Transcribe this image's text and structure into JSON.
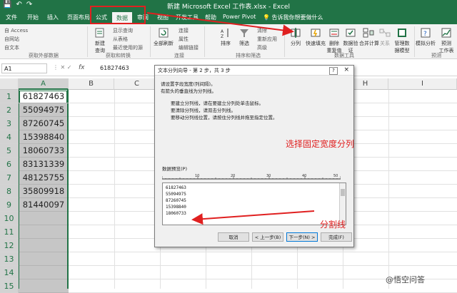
{
  "window": {
    "title": "新建 Microsoft Excel 工作表.xlsx  -  Excel"
  },
  "tabs": [
    "文件",
    "开始",
    "插入",
    "页面布局",
    "公式",
    "数据",
    "审阅",
    "视图",
    "开发工具",
    "帮助",
    "Power Pivot"
  ],
  "tell_me": "告诉我你想要做什么",
  "ribbon": {
    "external": {
      "items": [
        "自 Access",
        "自网站",
        "自文本"
      ],
      "group": "获取外部数据"
    },
    "get_transform": {
      "new_query": "新建\n查询",
      "items": [
        "显示查询",
        "从表格",
        "最近使用的源"
      ],
      "group": "获取和转换"
    },
    "connections": {
      "refresh_all": "全部刷新",
      "items": [
        "连接",
        "属性",
        "编辑链接"
      ],
      "group": "连接"
    },
    "sort_filter": {
      "sort": "排序",
      "filter": "筛选",
      "items": [
        "清除",
        "重新应用",
        "高级"
      ],
      "group": "排序和筛选"
    },
    "data_tools": {
      "items": [
        "分列",
        "快速填充",
        "删除\n重复值",
        "数据验\n证",
        "合并计算",
        "关系",
        "管理数\n据模型"
      ],
      "group": "数据工具"
    },
    "forecast": {
      "items": [
        "模拟分析",
        "预测\n工作表"
      ],
      "group": "预测"
    }
  },
  "formula_bar": {
    "name_box": "A1",
    "fx": "fx",
    "value": "61827463"
  },
  "columns": [
    "A",
    "B",
    "C",
    "D",
    "E",
    "F",
    "G",
    "H",
    "I"
  ],
  "rows": [
    "1",
    "2",
    "3",
    "4",
    "5",
    "6",
    "7",
    "8",
    "9",
    "10",
    "11",
    "12",
    "13",
    "14",
    "15"
  ],
  "cells_A": [
    "61827463",
    "55094975",
    "87260745",
    "15398840",
    "18060733",
    "83131339",
    "48125755",
    "35809918",
    "81440097"
  ],
  "dialog": {
    "title": "文本分列向导 - 第 2 步，共 3 步",
    "help": "?",
    "close": "×",
    "intro": [
      "请设置字段宽度(列间隔)。",
      "有箭头的垂直线为分列线。"
    ],
    "instructions": [
      "要建立分列线，请在要建立分列处单击鼠标。",
      "要清除分列线，请双击分列线。",
      "要移动分列线位置，请按住分列线并拖至指定位置。"
    ],
    "preview_label": "数据预览(P)",
    "ruler_ticks": [
      "10",
      "20",
      "30",
      "40",
      "50"
    ],
    "preview_rows": [
      "61827463",
      "55094975",
      "87260745",
      "15398840",
      "18060733"
    ],
    "buttons": {
      "cancel": "取消",
      "back": "< 上一步(B)",
      "next": "下一步(N) >",
      "finish": "完成(F)"
    }
  },
  "annotations": {
    "fixed_width": "选择固定宽度分列",
    "split_line": "分割线"
  },
  "watermark": "@悟空问答",
  "colors": {
    "excel_green": "#217346",
    "annotation_red": "#e02020",
    "selection_gray": "#c6c6c6"
  }
}
